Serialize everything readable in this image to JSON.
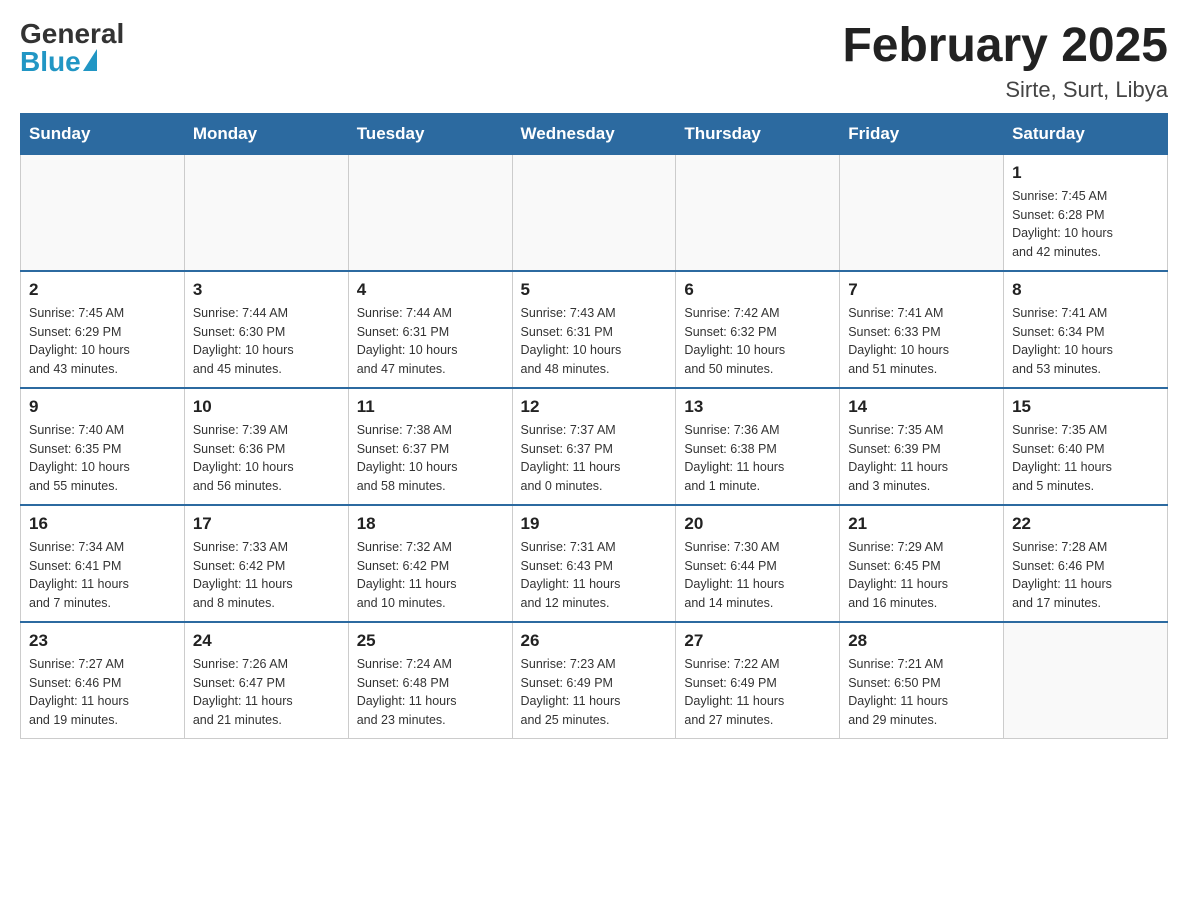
{
  "logo": {
    "general": "General",
    "blue": "Blue"
  },
  "title": "February 2025",
  "location": "Sirte, Surt, Libya",
  "days_of_week": [
    "Sunday",
    "Monday",
    "Tuesday",
    "Wednesday",
    "Thursday",
    "Friday",
    "Saturday"
  ],
  "weeks": [
    [
      {
        "day": "",
        "info": ""
      },
      {
        "day": "",
        "info": ""
      },
      {
        "day": "",
        "info": ""
      },
      {
        "day": "",
        "info": ""
      },
      {
        "day": "",
        "info": ""
      },
      {
        "day": "",
        "info": ""
      },
      {
        "day": "1",
        "info": "Sunrise: 7:45 AM\nSunset: 6:28 PM\nDaylight: 10 hours\nand 42 minutes."
      }
    ],
    [
      {
        "day": "2",
        "info": "Sunrise: 7:45 AM\nSunset: 6:29 PM\nDaylight: 10 hours\nand 43 minutes."
      },
      {
        "day": "3",
        "info": "Sunrise: 7:44 AM\nSunset: 6:30 PM\nDaylight: 10 hours\nand 45 minutes."
      },
      {
        "day": "4",
        "info": "Sunrise: 7:44 AM\nSunset: 6:31 PM\nDaylight: 10 hours\nand 47 minutes."
      },
      {
        "day": "5",
        "info": "Sunrise: 7:43 AM\nSunset: 6:31 PM\nDaylight: 10 hours\nand 48 minutes."
      },
      {
        "day": "6",
        "info": "Sunrise: 7:42 AM\nSunset: 6:32 PM\nDaylight: 10 hours\nand 50 minutes."
      },
      {
        "day": "7",
        "info": "Sunrise: 7:41 AM\nSunset: 6:33 PM\nDaylight: 10 hours\nand 51 minutes."
      },
      {
        "day": "8",
        "info": "Sunrise: 7:41 AM\nSunset: 6:34 PM\nDaylight: 10 hours\nand 53 minutes."
      }
    ],
    [
      {
        "day": "9",
        "info": "Sunrise: 7:40 AM\nSunset: 6:35 PM\nDaylight: 10 hours\nand 55 minutes."
      },
      {
        "day": "10",
        "info": "Sunrise: 7:39 AM\nSunset: 6:36 PM\nDaylight: 10 hours\nand 56 minutes."
      },
      {
        "day": "11",
        "info": "Sunrise: 7:38 AM\nSunset: 6:37 PM\nDaylight: 10 hours\nand 58 minutes."
      },
      {
        "day": "12",
        "info": "Sunrise: 7:37 AM\nSunset: 6:37 PM\nDaylight: 11 hours\nand 0 minutes."
      },
      {
        "day": "13",
        "info": "Sunrise: 7:36 AM\nSunset: 6:38 PM\nDaylight: 11 hours\nand 1 minute."
      },
      {
        "day": "14",
        "info": "Sunrise: 7:35 AM\nSunset: 6:39 PM\nDaylight: 11 hours\nand 3 minutes."
      },
      {
        "day": "15",
        "info": "Sunrise: 7:35 AM\nSunset: 6:40 PM\nDaylight: 11 hours\nand 5 minutes."
      }
    ],
    [
      {
        "day": "16",
        "info": "Sunrise: 7:34 AM\nSunset: 6:41 PM\nDaylight: 11 hours\nand 7 minutes."
      },
      {
        "day": "17",
        "info": "Sunrise: 7:33 AM\nSunset: 6:42 PM\nDaylight: 11 hours\nand 8 minutes."
      },
      {
        "day": "18",
        "info": "Sunrise: 7:32 AM\nSunset: 6:42 PM\nDaylight: 11 hours\nand 10 minutes."
      },
      {
        "day": "19",
        "info": "Sunrise: 7:31 AM\nSunset: 6:43 PM\nDaylight: 11 hours\nand 12 minutes."
      },
      {
        "day": "20",
        "info": "Sunrise: 7:30 AM\nSunset: 6:44 PM\nDaylight: 11 hours\nand 14 minutes."
      },
      {
        "day": "21",
        "info": "Sunrise: 7:29 AM\nSunset: 6:45 PM\nDaylight: 11 hours\nand 16 minutes."
      },
      {
        "day": "22",
        "info": "Sunrise: 7:28 AM\nSunset: 6:46 PM\nDaylight: 11 hours\nand 17 minutes."
      }
    ],
    [
      {
        "day": "23",
        "info": "Sunrise: 7:27 AM\nSunset: 6:46 PM\nDaylight: 11 hours\nand 19 minutes."
      },
      {
        "day": "24",
        "info": "Sunrise: 7:26 AM\nSunset: 6:47 PM\nDaylight: 11 hours\nand 21 minutes."
      },
      {
        "day": "25",
        "info": "Sunrise: 7:24 AM\nSunset: 6:48 PM\nDaylight: 11 hours\nand 23 minutes."
      },
      {
        "day": "26",
        "info": "Sunrise: 7:23 AM\nSunset: 6:49 PM\nDaylight: 11 hours\nand 25 minutes."
      },
      {
        "day": "27",
        "info": "Sunrise: 7:22 AM\nSunset: 6:49 PM\nDaylight: 11 hours\nand 27 minutes."
      },
      {
        "day": "28",
        "info": "Sunrise: 7:21 AM\nSunset: 6:50 PM\nDaylight: 11 hours\nand 29 minutes."
      },
      {
        "day": "",
        "info": ""
      }
    ]
  ]
}
